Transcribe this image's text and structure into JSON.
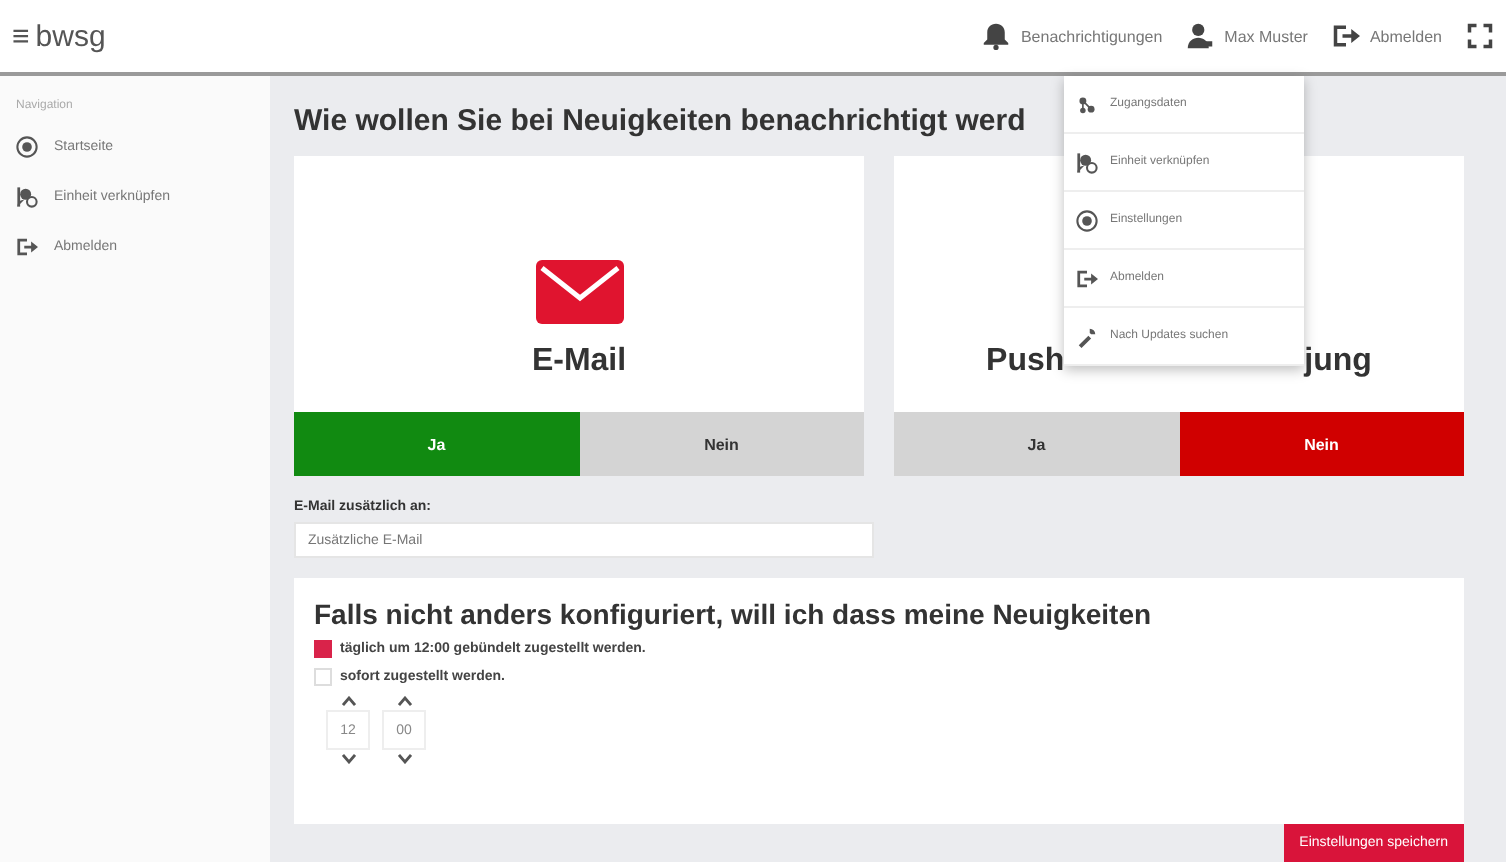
{
  "header": {
    "menu_icon": "≡",
    "brand": "bwsg",
    "actions": [
      {
        "kind": "bell",
        "label": "Benachrichtigungen"
      },
      {
        "kind": "user",
        "label": "Max Muster"
      },
      {
        "kind": "logout",
        "label": "Abmelden"
      },
      {
        "kind": "fullscreen"
      }
    ]
  },
  "sidebar": {
    "heading": "Navigation",
    "items": [
      {
        "kind": "home",
        "label": "Startseite"
      },
      {
        "kind": "link",
        "label": "Einheit verknüpfen"
      },
      {
        "kind": "logout",
        "label": "Abmelden"
      }
    ]
  },
  "page_title": "Wie wollen Sie bei Neuigkeiten benachrichtigt werd",
  "channels": [
    {
      "kind": "mail",
      "label_parts": [
        "E-Mail"
      ],
      "options": [
        {
          "kind": "yes",
          "label": "Ja",
          "selected": true
        },
        {
          "kind": "no",
          "label": "Nein",
          "selected": false
        }
      ]
    },
    {
      "kind": "push",
      "label_parts": [
        "Push",
        "jung"
      ],
      "options": [
        {
          "kind": "yes",
          "label": "Ja",
          "selected": false
        },
        {
          "kind": "no",
          "label": "Nein",
          "selected": true
        }
      ]
    }
  ],
  "extra_email": {
    "label": "E-Mail zusätzlich an:",
    "placeholder": "Zusätzliche E-Mail"
  },
  "schedule": {
    "title": "Falls nicht anders konfiguriert, will ich dass meine Neuigkeiten",
    "options": [
      {
        "label": "täglich um 12:00 gebündelt zugestellt werden.",
        "checked": true
      },
      {
        "label": "sofort zugestellt werden.",
        "checked": false
      }
    ],
    "hour": "12",
    "minute": "00"
  },
  "save_button": "Einstellungen speichern",
  "user_menu": {
    "items": [
      {
        "kind": "key",
        "label": "Zugangsdaten"
      },
      {
        "kind": "link",
        "label": "Einheit verknüpfen"
      },
      {
        "kind": "home",
        "label": "Einstellungen"
      },
      {
        "kind": "logout",
        "label": "Abmelden"
      },
      {
        "kind": "update",
        "label": "Nach Updates suchen"
      }
    ]
  }
}
